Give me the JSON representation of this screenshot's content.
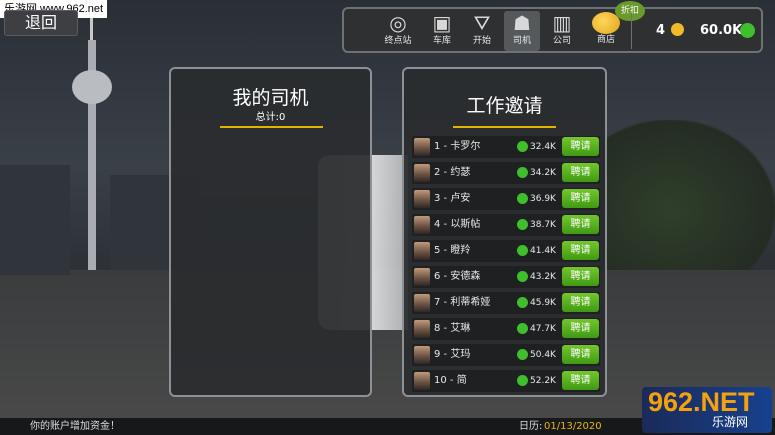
{
  "watermark_top": "乐游网 www.962.net",
  "back_label": "退回",
  "nav": [
    {
      "label": "终点站",
      "icon": "terminal-icon",
      "glyph": "◎"
    },
    {
      "label": "车库",
      "icon": "bus-icon",
      "glyph": "▣"
    },
    {
      "label": "开始",
      "icon": "map-pin-icon",
      "glyph": "⛛"
    },
    {
      "label": "司机",
      "icon": "driver-icon",
      "glyph": "☗"
    },
    {
      "label": "公司",
      "icon": "building-icon",
      "glyph": "▥"
    },
    {
      "label": "商店",
      "icon": "coin-stack-icon",
      "glyph": ""
    }
  ],
  "sale_badge": "折扣",
  "coins": "4",
  "cash": "60.0K",
  "my_drivers": {
    "title": "我的司机",
    "total": "总计:0"
  },
  "job_offers": {
    "title": "工作邀请",
    "hire_label": "聘请",
    "drivers": [
      {
        "name": "1 - 卡罗尔",
        "salary": "32.4K"
      },
      {
        "name": "2 - 约瑟",
        "salary": "34.2K"
      },
      {
        "name": "3 - 卢安",
        "salary": "36.9K"
      },
      {
        "name": "4 - 以斯帖",
        "salary": "38.7K"
      },
      {
        "name": "5 - 瞪羚",
        "salary": "41.4K"
      },
      {
        "name": "6 - 安德森",
        "salary": "43.2K"
      },
      {
        "name": "7 - 利蒂希娅",
        "salary": "45.9K"
      },
      {
        "name": "8 - 艾琳",
        "salary": "47.7K"
      },
      {
        "name": "9 - 艾玛",
        "salary": "50.4K"
      },
      {
        "name": "10 - 简",
        "salary": "52.2K"
      }
    ]
  },
  "ticker_message": "你的账户增加资金！",
  "date_label": "日历:",
  "date_value": "01/13/2020",
  "watermark_br": {
    "big": "962.NET",
    "small": "乐游网"
  },
  "colors": {
    "accent_gold": "#e1b400",
    "money_green": "#3fbf2c",
    "hire_green": "#4ea81c"
  }
}
